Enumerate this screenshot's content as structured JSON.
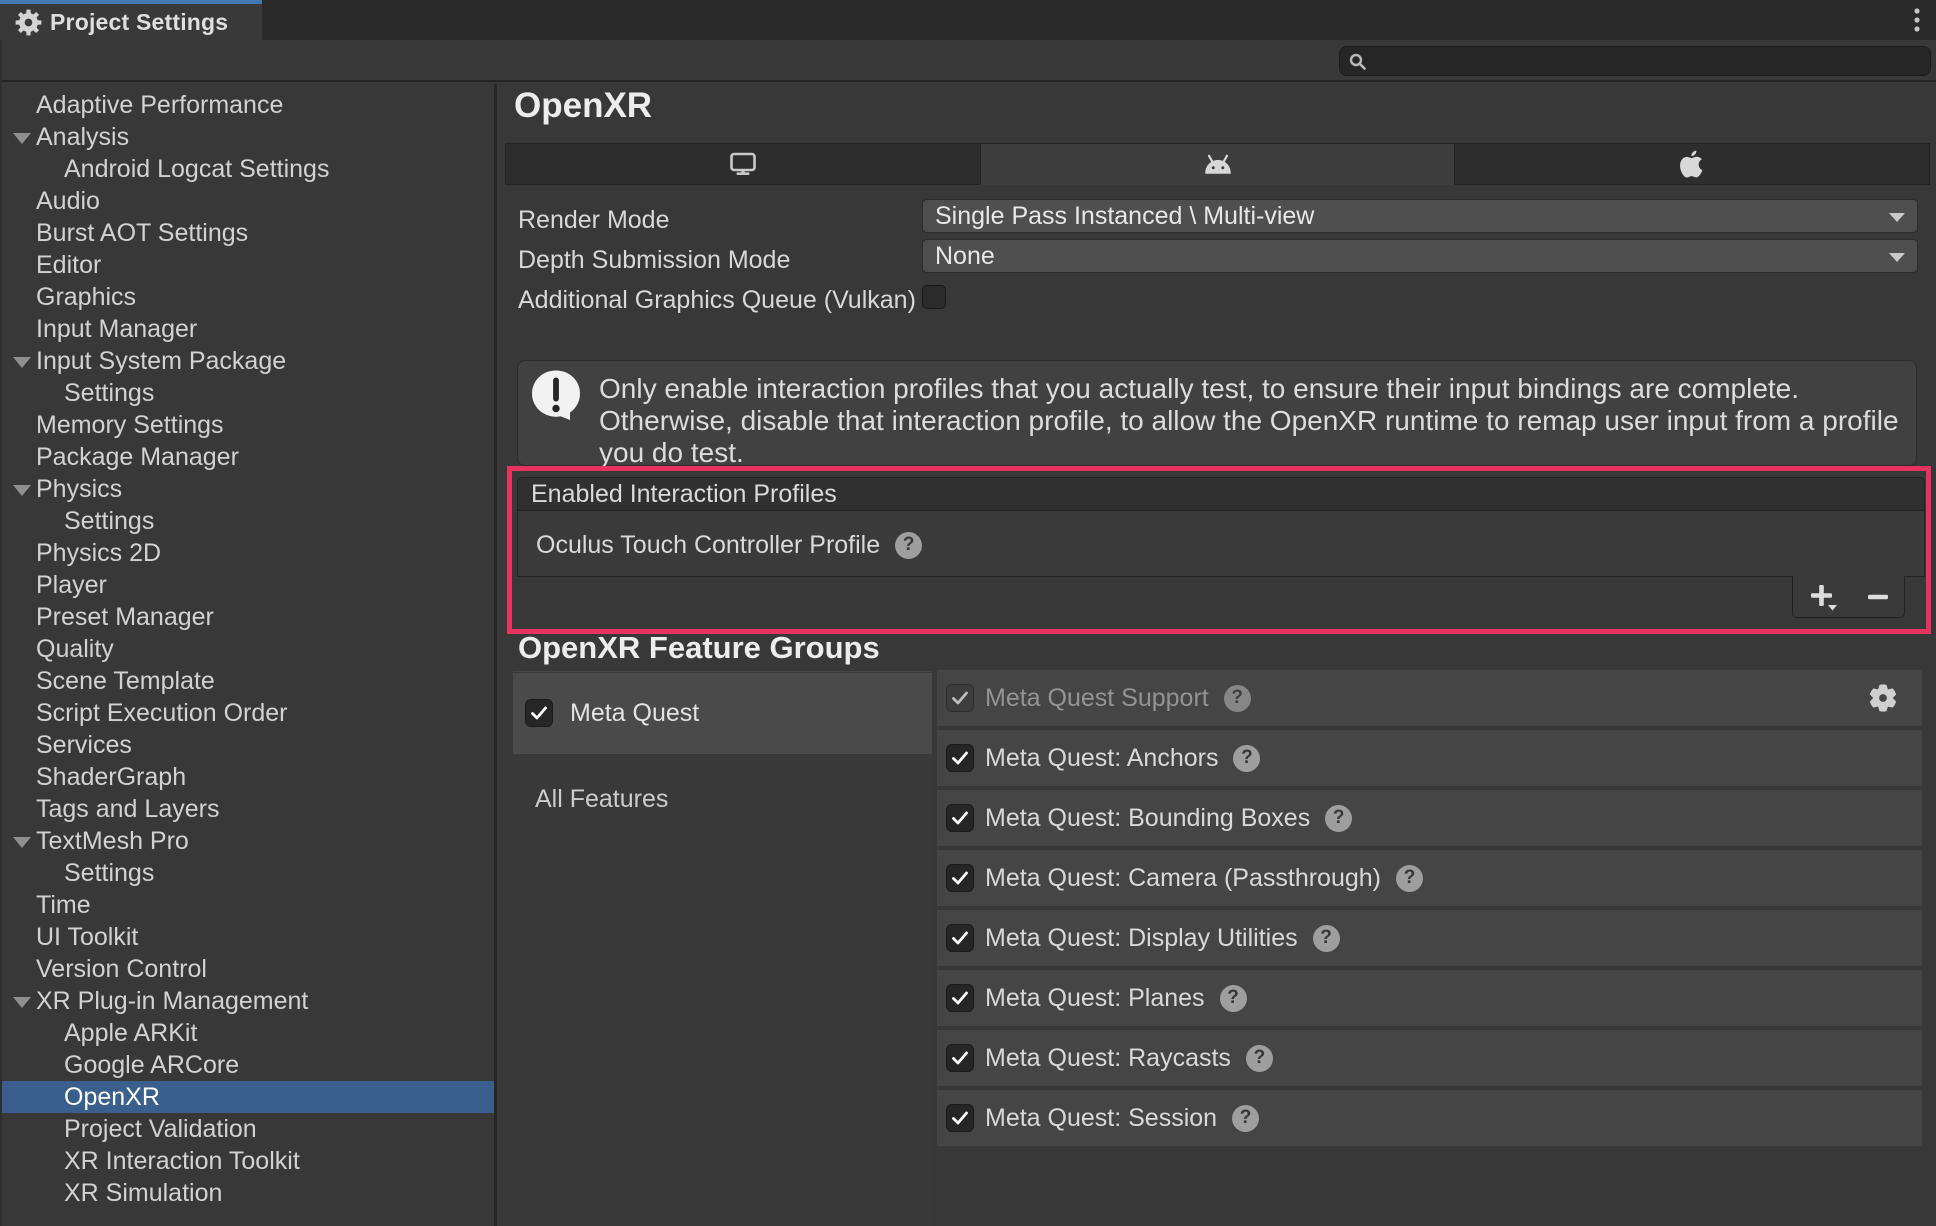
{
  "window": {
    "tab_title": "Project Settings"
  },
  "search": {
    "value": ""
  },
  "sidebar": {
    "items": [
      {
        "label": "Adaptive Performance"
      },
      {
        "label": "Analysis",
        "expanded": true
      },
      {
        "label": "Android Logcat Settings",
        "indent": 1
      },
      {
        "label": "Audio"
      },
      {
        "label": "Burst AOT Settings"
      },
      {
        "label": "Editor"
      },
      {
        "label": "Graphics"
      },
      {
        "label": "Input Manager"
      },
      {
        "label": "Input System Package",
        "expanded": true
      },
      {
        "label": "Settings",
        "indent": 1
      },
      {
        "label": "Memory Settings"
      },
      {
        "label": "Package Manager"
      },
      {
        "label": "Physics",
        "expanded": true
      },
      {
        "label": "Settings",
        "indent": 1
      },
      {
        "label": "Physics 2D"
      },
      {
        "label": "Player"
      },
      {
        "label": "Preset Manager"
      },
      {
        "label": "Quality"
      },
      {
        "label": "Scene Template"
      },
      {
        "label": "Script Execution Order"
      },
      {
        "label": "Services"
      },
      {
        "label": "ShaderGraph"
      },
      {
        "label": "Tags and Layers"
      },
      {
        "label": "TextMesh Pro",
        "expanded": true
      },
      {
        "label": "Settings",
        "indent": 1
      },
      {
        "label": "Time"
      },
      {
        "label": "UI Toolkit"
      },
      {
        "label": "Version Control"
      },
      {
        "label": "XR Plug-in Management",
        "expanded": true
      },
      {
        "label": "Apple ARKit",
        "indent": 1
      },
      {
        "label": "Google ARCore",
        "indent": 1
      },
      {
        "label": "OpenXR",
        "indent": 1,
        "selected": true
      },
      {
        "label": "Project Validation",
        "indent": 1
      },
      {
        "label": "XR Interaction Toolkit",
        "indent": 1
      },
      {
        "label": "XR Simulation",
        "indent": 1
      }
    ]
  },
  "main": {
    "title": "OpenXR",
    "platform_tabs": [
      {
        "icon": "desktop-icon",
        "selected": false
      },
      {
        "icon": "android-icon",
        "selected": true
      },
      {
        "icon": "apple-icon",
        "selected": false
      }
    ],
    "fields": {
      "render_mode": {
        "label": "Render Mode",
        "value": "Single Pass Instanced \\ Multi-view"
      },
      "depth_submission_mode": {
        "label": "Depth Submission Mode",
        "value": "None"
      },
      "additional_graphics_queue": {
        "label": "Additional Graphics Queue (Vulkan)",
        "checked": false
      }
    },
    "warning": {
      "text": "Only enable interaction profiles that you actually test, to ensure their input bindings are complete.\nOtherwise, disable that interaction profile, to allow the OpenXR runtime to remap user input from a profile\nyou do test."
    },
    "interaction_profiles": {
      "header": "Enabled Interaction Profiles",
      "items": [
        {
          "label": "Oculus Touch Controller Profile",
          "help": true
        }
      ],
      "add_label": "+",
      "remove_label": "−"
    },
    "feature_groups": {
      "title": "OpenXR Feature Groups",
      "groups": [
        {
          "label": "Meta Quest",
          "checked": true,
          "selected": true
        }
      ],
      "all_features_label": "All Features",
      "features": [
        {
          "label": "Meta Quest Support",
          "checked": true,
          "disabled": true,
          "gear": true,
          "help": true
        },
        {
          "label": "Meta Quest: Anchors",
          "checked": true,
          "help": true
        },
        {
          "label": "Meta Quest: Bounding Boxes",
          "checked": true,
          "help": true
        },
        {
          "label": "Meta Quest: Camera (Passthrough)",
          "checked": true,
          "help": true
        },
        {
          "label": "Meta Quest: Display Utilities",
          "checked": true,
          "help": true
        },
        {
          "label": "Meta Quest: Planes",
          "checked": true,
          "help": true
        },
        {
          "label": "Meta Quest: Raycasts",
          "checked": true,
          "help": true
        },
        {
          "label": "Meta Quest: Session",
          "checked": true,
          "help": true
        }
      ]
    },
    "annotation_color": "#e8325f",
    "help_glyph": "?"
  }
}
